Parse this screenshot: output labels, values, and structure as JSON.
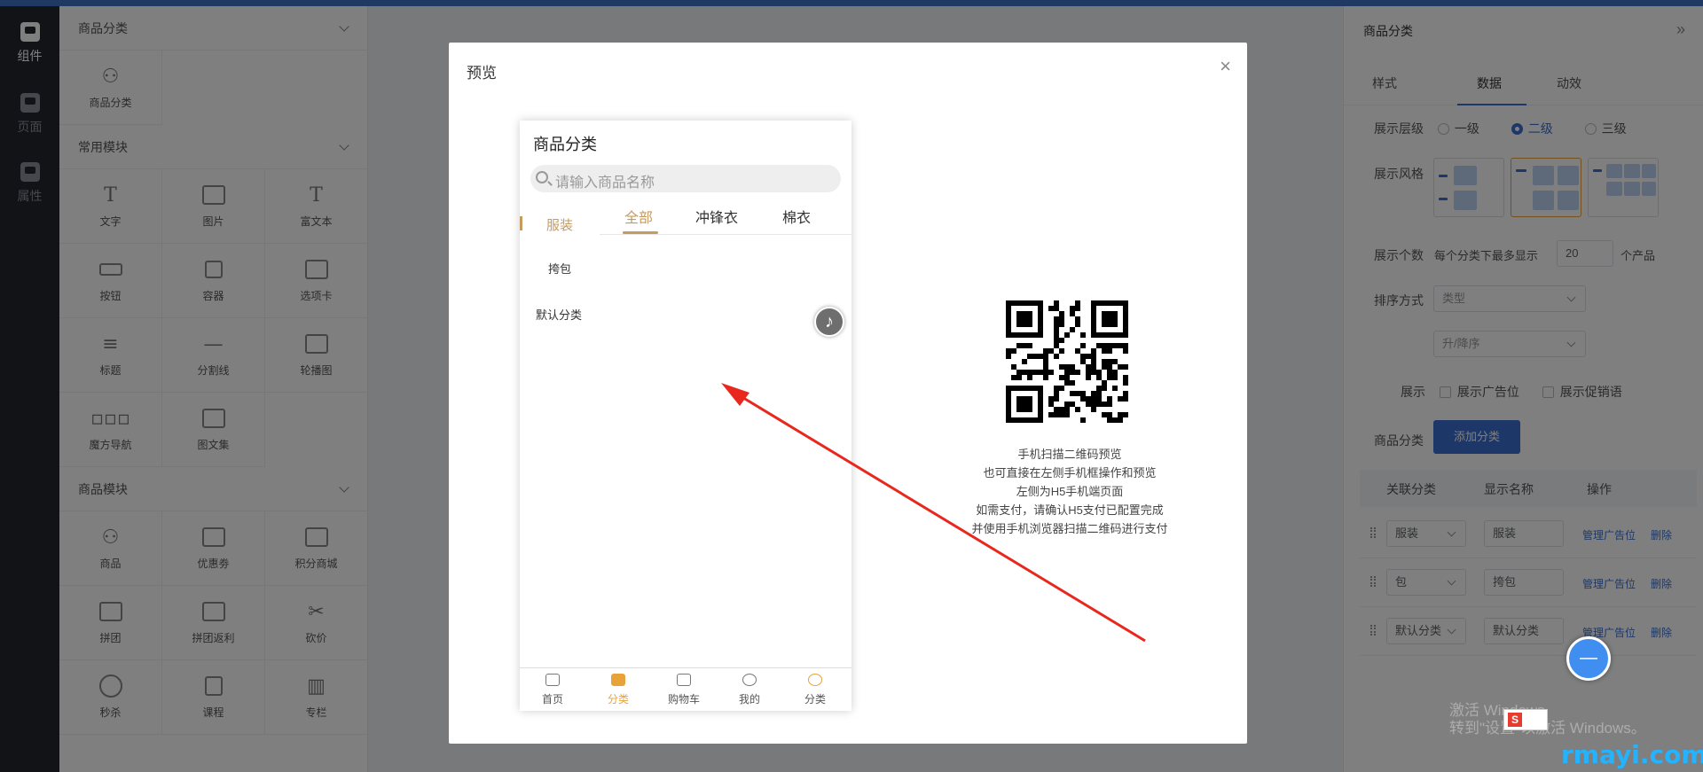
{
  "nav": {
    "items": [
      {
        "label": "组件",
        "icon": "component-icon",
        "active": true
      },
      {
        "label": "页面",
        "icon": "page-icon",
        "active": false
      },
      {
        "label": "属性",
        "icon": "property-icon",
        "active": false
      }
    ]
  },
  "library": {
    "sections": [
      {
        "title": "商品分类",
        "items": [
          {
            "label": "商品分类",
            "icon": "category-grid-icon"
          }
        ]
      },
      {
        "title": "常用模块",
        "items": [
          {
            "label": "文字",
            "icon": "text-icon"
          },
          {
            "label": "图片",
            "icon": "image-icon"
          },
          {
            "label": "富文本",
            "icon": "rich-text-icon"
          },
          {
            "label": "按钮",
            "icon": "button-icon"
          },
          {
            "label": "容器",
            "icon": "container-icon"
          },
          {
            "label": "选项卡",
            "icon": "tab-icon"
          },
          {
            "label": "标题",
            "icon": "title-icon"
          },
          {
            "label": "分割线",
            "icon": "divider-icon"
          },
          {
            "label": "轮播图",
            "icon": "carousel-icon"
          },
          {
            "label": "魔方导航",
            "icon": "cube-nav-icon"
          },
          {
            "label": "图文集",
            "icon": "image-text-icon"
          }
        ]
      },
      {
        "title": "商品模块",
        "items": [
          {
            "label": "商品",
            "icon": "goods-icon"
          },
          {
            "label": "优惠劵",
            "icon": "coupon-icon"
          },
          {
            "label": "积分商城",
            "icon": "points-mall-icon"
          },
          {
            "label": "拼团",
            "icon": "group-buy-icon"
          },
          {
            "label": "拼团返利",
            "icon": "group-rebate-icon"
          },
          {
            "label": "砍价",
            "icon": "bargain-icon"
          },
          {
            "label": "秒杀",
            "icon": "flash-sale-icon"
          },
          {
            "label": "课程",
            "icon": "course-icon"
          },
          {
            "label": "专栏",
            "icon": "column-icon"
          }
        ]
      }
    ]
  },
  "props": {
    "title": "商品分类",
    "tabs": [
      "样式",
      "数据",
      "动效"
    ],
    "active_tab": "数据",
    "level_label": "展示层级",
    "levels": [
      "一级",
      "二级",
      "三级"
    ],
    "selected_level": "二级",
    "style_label": "展示风格",
    "count_label": "展示个数",
    "count_prefix": "每个分类下最多显示",
    "count_value": "20",
    "count_suffix": "个产品",
    "sort_label": "排序方式",
    "sort_field": "类型",
    "sort_order": "升/降序",
    "show_label": "展示",
    "show_ad": "展示广告位",
    "show_promo": "展示促销语",
    "category_label": "商品分类",
    "add_button": "添加分类",
    "table_headers": [
      "关联分类",
      "显示名称",
      "操作"
    ],
    "rows": [
      {
        "category": "服装",
        "name": "服装"
      },
      {
        "category": "包",
        "name": "挎包"
      },
      {
        "category": "默认分类",
        "name": "默认分类"
      }
    ],
    "manage_ad": "管理广告位",
    "delete": "删除"
  },
  "modal": {
    "title": "预览",
    "close": "×",
    "phone": {
      "title": "商品分类",
      "search_placeholder": "请输入商品名称",
      "active_category": "服装",
      "tabs": [
        "全部",
        "冲锋衣",
        "棉衣"
      ],
      "categories": [
        "挎包",
        "默认分类"
      ],
      "tabbar": [
        {
          "label": "首页",
          "icon": "home-icon"
        },
        {
          "label": "分类",
          "icon": "category-icon"
        },
        {
          "label": "购物车",
          "icon": "cart-icon"
        },
        {
          "label": "我的",
          "icon": "user-icon"
        },
        {
          "label": "分类",
          "icon": "emoji-category-icon"
        }
      ]
    },
    "qr_text": [
      "手机扫描二维码预览",
      "也可直接在左侧手机框操作和预览",
      "左侧为H5手机端页面",
      "如需支付，请确认H5支付已配置完成",
      "并使用手机浏览器扫描二维码进行支付"
    ]
  },
  "overlay": {
    "watermark_1": "激活 Windows",
    "watermark_2": "转到\"设置\"以激活 Windows。",
    "brand": "rmayi.com",
    "ime": "S"
  },
  "colors": {
    "accent": "#3b6fd1",
    "gold": "#c59b5f",
    "orange": "#e8a23a",
    "arrow": "#e8281e"
  }
}
